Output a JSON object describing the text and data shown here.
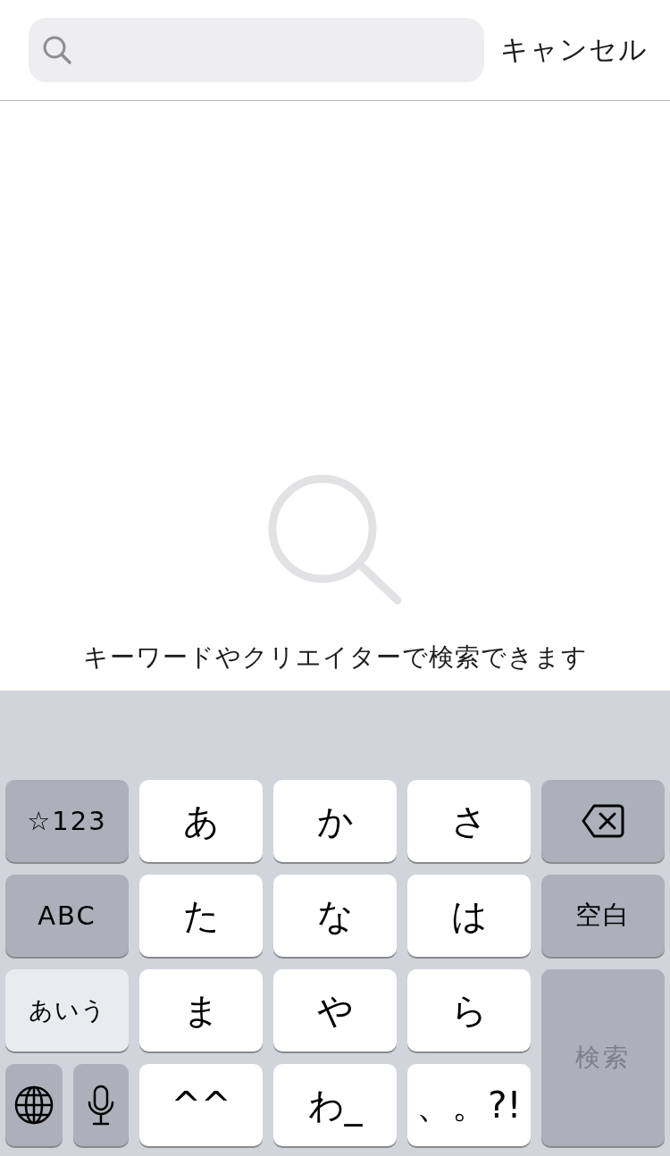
{
  "search_bar": {
    "cancel": "キャンセル"
  },
  "empty_state": {
    "message": "キーワードやクリエイターで検索できます"
  },
  "keyboard": {
    "rows": [
      [
        {
          "kind": "function",
          "label": "☆123"
        },
        {
          "kind": "char",
          "label": "あ"
        },
        {
          "kind": "char",
          "label": "か"
        },
        {
          "kind": "char",
          "label": "さ"
        },
        {
          "kind": "delete"
        }
      ],
      [
        {
          "kind": "function",
          "label": "ABC"
        },
        {
          "kind": "char",
          "label": "た"
        },
        {
          "kind": "char",
          "label": "な"
        },
        {
          "kind": "char",
          "label": "は"
        },
        {
          "kind": "function",
          "label": "空白"
        }
      ],
      [
        {
          "kind": "current-mode",
          "label": "あいう"
        },
        {
          "kind": "char",
          "label": "ま"
        },
        {
          "kind": "char",
          "label": "や"
        },
        {
          "kind": "char",
          "label": "ら"
        },
        {
          "kind": "search",
          "label": "検索",
          "disabled": true
        }
      ],
      [
        {
          "kind": "pair",
          "keys": [
            {
              "kind": "globe"
            },
            {
              "kind": "mic"
            }
          ]
        },
        {
          "kind": "char",
          "label": "^^"
        },
        {
          "kind": "char",
          "label": "わ_"
        },
        {
          "kind": "char",
          "label": "、。?!"
        }
      ]
    ]
  }
}
